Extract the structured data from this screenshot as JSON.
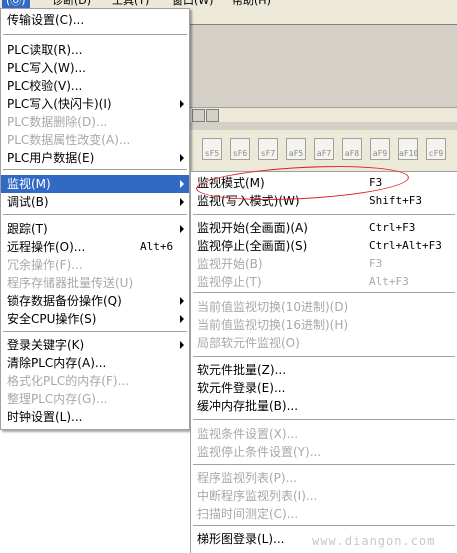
{
  "menubar": {
    "items": [
      "(Ⓞ)",
      "诊断(D)",
      "工具(T)",
      "窗口(W)",
      "帮助(H)"
    ]
  },
  "function_keys": [
    "sF5",
    "sF6",
    "sF7",
    "aF5",
    "aF7",
    "aF8",
    "aF9",
    "aF10",
    "cF9"
  ],
  "left_menu": {
    "items": [
      {
        "label": "传输设置(C)...",
        "shortcut": "",
        "submenu": false,
        "disabled": false,
        "highlighted": false
      },
      {
        "label": "PLC读取(R)...",
        "shortcut": "",
        "submenu": false,
        "disabled": false,
        "highlighted": false
      },
      {
        "label": "PLC写入(W)...",
        "shortcut": "",
        "submenu": false,
        "disabled": false,
        "highlighted": false
      },
      {
        "label": "PLC校验(V)...",
        "shortcut": "",
        "submenu": false,
        "disabled": false,
        "highlighted": false
      },
      {
        "label": "PLC写入(快闪卡)(I)",
        "shortcut": "",
        "submenu": true,
        "disabled": false,
        "highlighted": false
      },
      {
        "label": "PLC数据删除(D)...",
        "shortcut": "",
        "submenu": false,
        "disabled": true,
        "highlighted": false
      },
      {
        "label": "PLC数据属性改变(A)...",
        "shortcut": "",
        "submenu": false,
        "disabled": true,
        "highlighted": false
      },
      {
        "label": "PLC用户数据(E)",
        "shortcut": "",
        "submenu": true,
        "disabled": false,
        "highlighted": false
      },
      {
        "label": "监视(M)",
        "shortcut": "",
        "submenu": true,
        "disabled": false,
        "highlighted": true
      },
      {
        "label": "调试(B)",
        "shortcut": "",
        "submenu": true,
        "disabled": false,
        "highlighted": false
      },
      {
        "label": "跟踪(T)",
        "shortcut": "",
        "submenu": true,
        "disabled": false,
        "highlighted": false
      },
      {
        "label": "远程操作(O)...",
        "shortcut": "Alt+6",
        "submenu": false,
        "disabled": false,
        "highlighted": false
      },
      {
        "label": "冗余操作(F)...",
        "shortcut": "",
        "submenu": false,
        "disabled": true,
        "highlighted": false
      },
      {
        "label": "程序存储器批量传送(U)",
        "shortcut": "",
        "submenu": false,
        "disabled": true,
        "highlighted": false
      },
      {
        "label": "锁存数据备份操作(Q)",
        "shortcut": "",
        "submenu": true,
        "disabled": false,
        "highlighted": false
      },
      {
        "label": "安全CPU操作(S)",
        "shortcut": "",
        "submenu": true,
        "disabled": false,
        "highlighted": false
      },
      {
        "label": "登录关键字(K)",
        "shortcut": "",
        "submenu": true,
        "disabled": false,
        "highlighted": false
      },
      {
        "label": "清除PLC内存(A)...",
        "shortcut": "",
        "submenu": false,
        "disabled": false,
        "highlighted": false
      },
      {
        "label": "格式化PLC的内存(F)...",
        "shortcut": "",
        "submenu": false,
        "disabled": true,
        "highlighted": false
      },
      {
        "label": "整理PLC内存(G)...",
        "shortcut": "",
        "submenu": false,
        "disabled": true,
        "highlighted": false
      },
      {
        "label": "时钟设置(L)...",
        "shortcut": "",
        "submenu": false,
        "disabled": false,
        "highlighted": false
      }
    ]
  },
  "right_menu": {
    "items": [
      {
        "label": "监视模式(M)",
        "shortcut": "F3",
        "disabled": false
      },
      {
        "label": "监视(写入模式)(W)",
        "shortcut": "Shift+F3",
        "disabled": false
      },
      {
        "label": "监视开始(全画面)(A)",
        "shortcut": "Ctrl+F3",
        "disabled": false
      },
      {
        "label": "监视停止(全画面)(S)",
        "shortcut": "Ctrl+Alt+F3",
        "disabled": false
      },
      {
        "label": "监视开始(B)",
        "shortcut": "F3",
        "disabled": true
      },
      {
        "label": "监视停止(T)",
        "shortcut": "Alt+F3",
        "disabled": true
      },
      {
        "label": "当前值监视切换(10进制)(D)",
        "shortcut": "",
        "disabled": true
      },
      {
        "label": "当前值监视切换(16进制)(H)",
        "shortcut": "",
        "disabled": true
      },
      {
        "label": "局部软元件监视(O)",
        "shortcut": "",
        "disabled": true
      },
      {
        "label": "软元件批量(Z)...",
        "shortcut": "",
        "disabled": false
      },
      {
        "label": "软元件登录(E)...",
        "shortcut": "",
        "disabled": false
      },
      {
        "label": "缓冲内存批量(B)...",
        "shortcut": "",
        "disabled": false
      },
      {
        "label": "监视条件设置(X)...",
        "shortcut": "",
        "disabled": true
      },
      {
        "label": "监视停止条件设置(Y)...",
        "shortcut": "",
        "disabled": true
      },
      {
        "label": "程序监视列表(P)...",
        "shortcut": "",
        "disabled": true
      },
      {
        "label": "中断程序监视列表(I)...",
        "shortcut": "",
        "disabled": true
      },
      {
        "label": "扫描时间测定(C)...",
        "shortcut": "",
        "disabled": true
      },
      {
        "label": "梯形图登录(L)...",
        "shortcut": "",
        "disabled": false
      }
    ]
  },
  "watermark": "www.diangon.com",
  "colors": {
    "highlight": "#316ac5",
    "annotation": "#e02020",
    "disabled_text": "#a8a8a8",
    "chrome": "#ece9d8"
  }
}
